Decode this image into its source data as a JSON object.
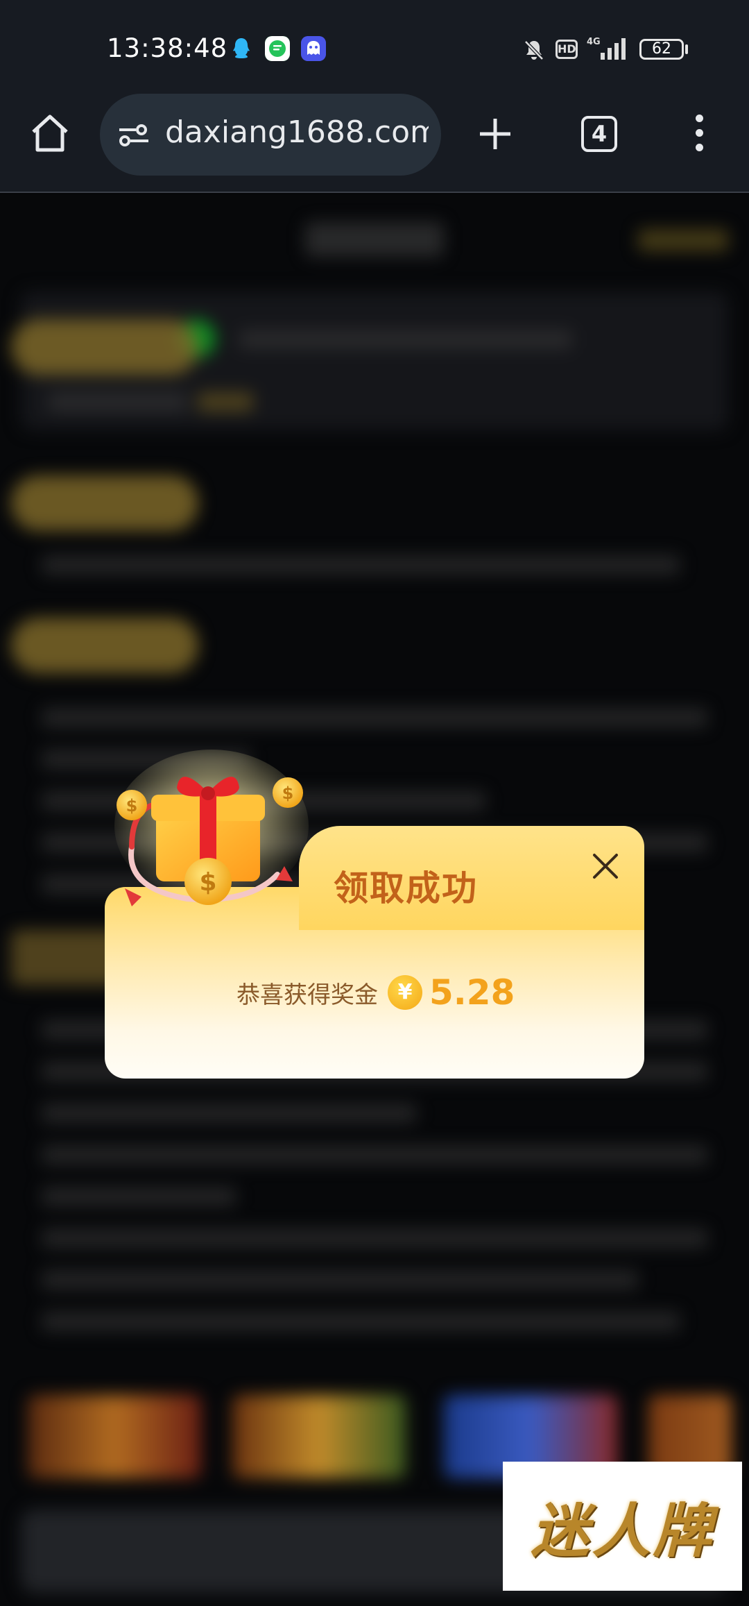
{
  "status_bar": {
    "time": "13:38:48",
    "battery": "62",
    "hd_label": "HD",
    "network_label": "4G"
  },
  "browser": {
    "url": "daxiang1688.com",
    "tab_count": "4"
  },
  "modal": {
    "title": "领取成功",
    "reward_label": "恭喜获得奖金",
    "currency_symbol": "¥",
    "reward_amount": "5.28"
  },
  "watermark": {
    "text": "迷人牌"
  },
  "colors": {
    "modal_title": "#c2621a",
    "reward_amount": "#f3a21c",
    "toolbar_bg": "#171b22"
  }
}
